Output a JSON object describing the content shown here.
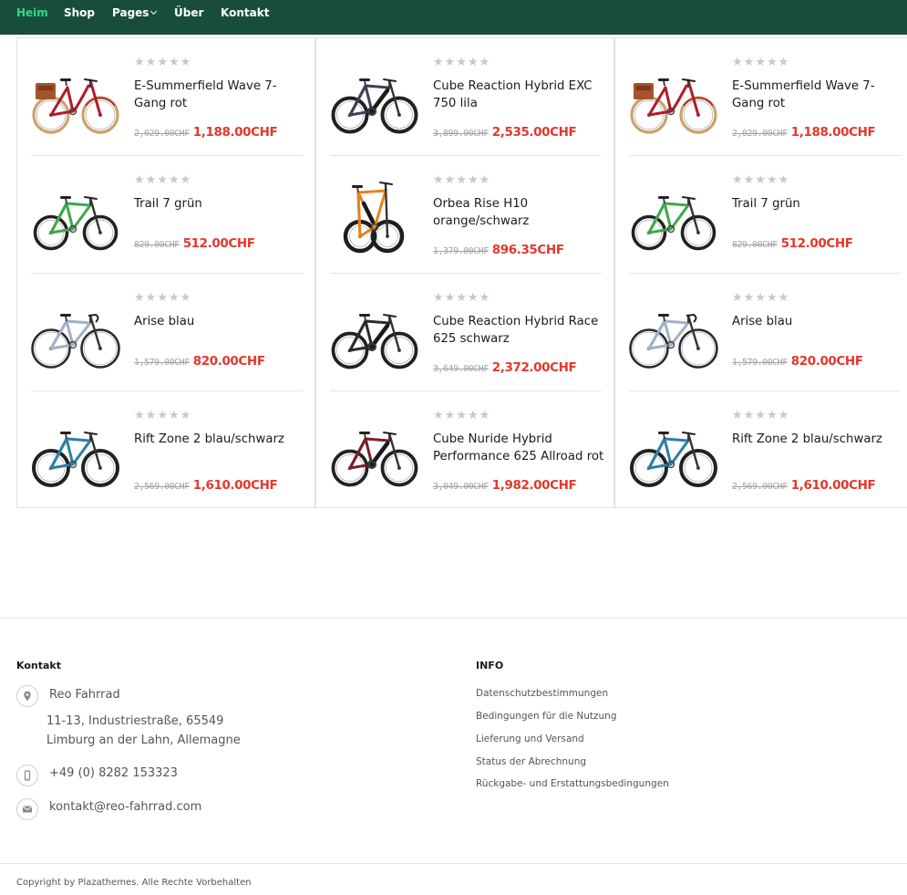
{
  "nav": {
    "items": [
      {
        "label": "Heim",
        "active": true
      },
      {
        "label": "Shop",
        "active": false
      },
      {
        "label": "Pages",
        "active": false,
        "has_dropdown": true
      },
      {
        "label": "Über",
        "active": false
      },
      {
        "label": "Kontakt",
        "active": false
      }
    ]
  },
  "columns": [
    {
      "products": [
        {
          "name": "E-Summerfield Wave 7-Gang rot",
          "old_price": "2,029.00CHF",
          "price": "1,188.00CHF",
          "rating": 0,
          "frame_color": "#b5192a",
          "image": "red-city-bike"
        },
        {
          "name": "Trail 7 grün",
          "old_price": "829.00CHF",
          "price": "512.00CHF",
          "rating": 0,
          "frame_color": "#3ea84c",
          "image": "green-mountain-bike"
        },
        {
          "name": "Arise blau",
          "old_price": "1,579.00CHF",
          "price": "820.00CHF",
          "rating": 0,
          "frame_color": "#9fb1c8",
          "image": "blue-gravel-bike"
        },
        {
          "name": "Rift Zone 2 blau/schwarz",
          "old_price": "2,569.00CHF",
          "price": "1,610.00CHF",
          "rating": 0,
          "frame_color": "#2d7fa8",
          "image": "blue-black-mountain-bike"
        }
      ]
    },
    {
      "products": [
        {
          "name": "Cube Reaction Hybrid EXC 750 lila",
          "old_price": "3,899.00CHF",
          "price": "2,535.00CHF",
          "rating": 0,
          "frame_color": "#4a3a55",
          "image": "purple-ebike"
        },
        {
          "name": "Orbea Rise H10 orange/schwarz",
          "old_price": "1,379.00CHF",
          "price": "896.35CHF",
          "rating": 0,
          "frame_color": "#e8821e",
          "image": "orange-full-suspension-bike"
        },
        {
          "name": "Cube Reaction Hybrid Race 625 schwarz",
          "old_price": "3,649.00CHF",
          "price": "2,372.00CHF",
          "rating": 0,
          "frame_color": "#2b2b2e",
          "image": "black-ebike"
        },
        {
          "name": "Cube Nuride Hybrid Performance 625 Allroad rot",
          "old_price": "3,049.00CHF",
          "price": "1,982.00CHF",
          "rating": 0,
          "frame_color": "#7a1f2b",
          "image": "red-trekking-ebike"
        }
      ]
    },
    {
      "products": [
        {
          "name": "E-Summerfield Wave 7-Gang rot",
          "old_price": "2,029.00CHF",
          "price": "1,188.00CHF",
          "rating": 0,
          "frame_color": "#b5192a",
          "image": "red-city-bike"
        },
        {
          "name": "Trail 7 grün",
          "old_price": "829.00CHF",
          "price": "512.00CHF",
          "rating": 0,
          "frame_color": "#3ea84c",
          "image": "green-mountain-bike"
        },
        {
          "name": "Arise blau",
          "old_price": "1,579.00CHF",
          "price": "820.00CHF",
          "rating": 0,
          "frame_color": "#9fb1c8",
          "image": "blue-gravel-bike"
        },
        {
          "name": "Rift Zone 2 blau/schwarz",
          "old_price": "2,569.00CHF",
          "price": "1,610.00CHF",
          "rating": 0,
          "frame_color": "#2d7fa8",
          "image": "blue-black-mountain-bike"
        }
      ]
    }
  ],
  "footer": {
    "contact_heading": "Kontakt",
    "company": "Reo Fahrrad",
    "address_line1": "11-13, Industriestraße, 65549",
    "address_line2": "Limburg an der Lahn, Allemagne",
    "phone": "+49 (0) 8282 153323",
    "email": "kontakt@reo-fahrrad.com",
    "info_heading": "INFO",
    "info_links": [
      "Datenschutzbestimmungen",
      "Bedingungen für die Nutzung",
      "Lieferung und Versand",
      "Status der Abrechnung",
      "Rückgabe- und Erstattungsbedingungen"
    ],
    "copyright": "Copyright by Plazathemes. Alle Rechte Vorbehalten"
  },
  "colors": {
    "nav_bg": "#184d3e",
    "nav_active": "#2fdc84",
    "sale_price": "#e3382c",
    "star_empty": "#c8c8c8"
  },
  "icons": {
    "address": "map-pin-icon",
    "phone": "mobile-phone-icon",
    "email": "envelope-icon",
    "rating": "star-icon"
  }
}
